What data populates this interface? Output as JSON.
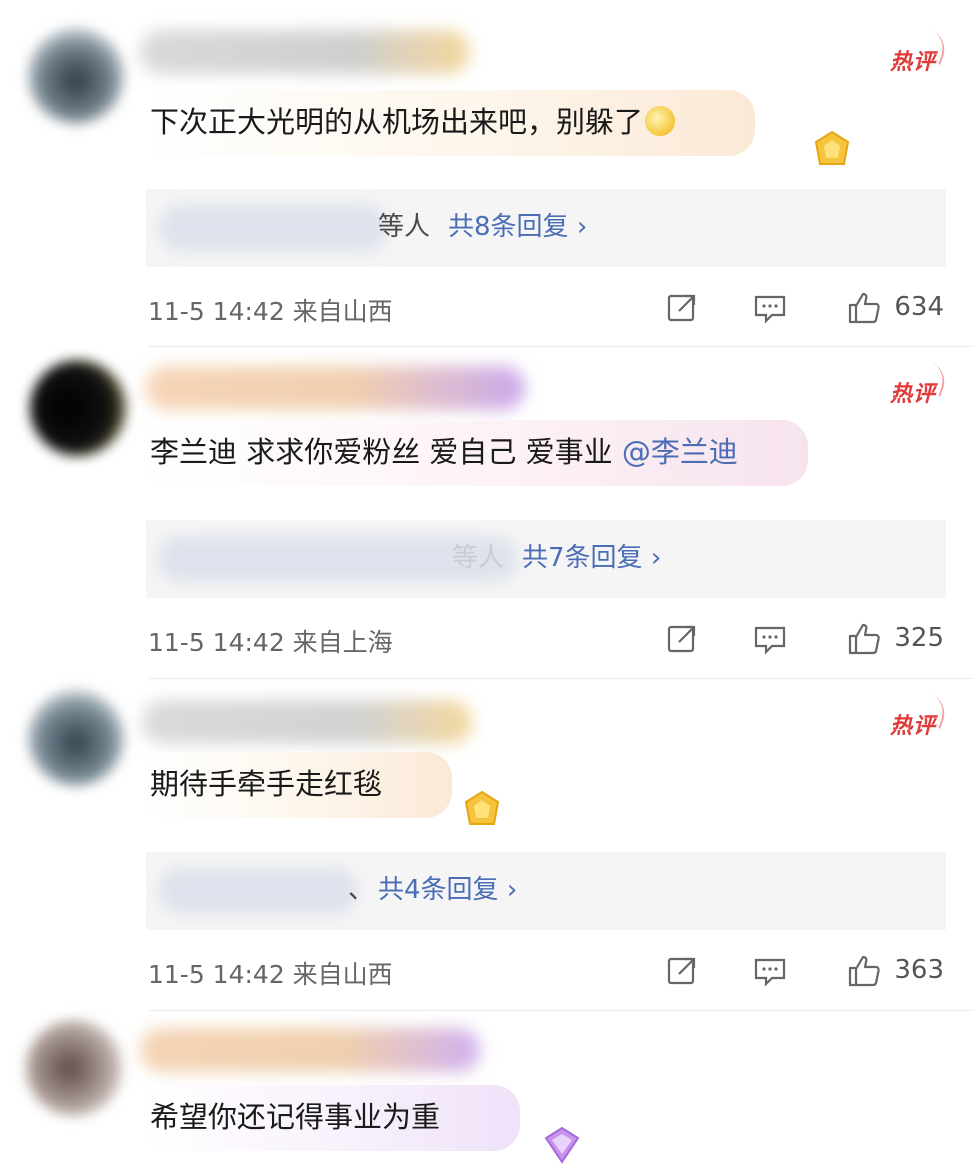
{
  "hot_label": "热评",
  "comments": [
    {
      "text": "下次正大光明的从机场出来吧，别躲了",
      "emoji": "🤔",
      "reply_others": "等人",
      "reply_count": "共8条回复 ›",
      "time_location": "11-5 14:42 来自山西",
      "likes": "634"
    },
    {
      "text": "李兰迪 求求你爱粉丝 爱自己 爱事业 ",
      "mention": "@李兰迪",
      "reply_others": "等人",
      "reply_count": "共7条回复 ›",
      "time_location": "11-5 14:42 来自上海",
      "likes": "325"
    },
    {
      "text": "期待手牵手走红毯",
      "reply_others": "、",
      "reply_count": "共4条回复 ›",
      "time_location": "11-5 14:42 来自山西",
      "likes": "363"
    },
    {
      "text": "希望你还记得事业为重"
    }
  ],
  "colors": {
    "link_blue": "#4b6db5",
    "hot_red": "#e23a3a",
    "reply_bg": "#f5f5f5"
  },
  "icons": [
    "share-icon",
    "comment-icon",
    "thumbs-up-icon",
    "gold-badge-icon",
    "purple-badge-icon"
  ]
}
